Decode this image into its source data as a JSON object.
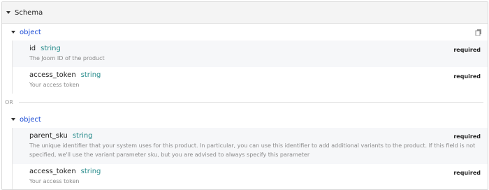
{
  "schema": {
    "title": "Schema"
  },
  "options": [
    {
      "type_label": "object",
      "properties": [
        {
          "name": "id",
          "type": "string",
          "required": "required",
          "description": "The Joom ID of the product"
        },
        {
          "name": "access_token",
          "type": "string",
          "required": "required",
          "description": "Your access token"
        }
      ]
    },
    {
      "type_label": "object",
      "properties": [
        {
          "name": "parent_sku",
          "type": "string",
          "required": "required",
          "description": "The unique identifier that your system uses for this product. In particular, you can use this identifier to add additional variants to the product. If this field is not specified, we'll use the variant parameter sku, but you are advised to always specify this parameter"
        },
        {
          "name": "access_token",
          "type": "string",
          "required": "required",
          "description": "Your access token"
        }
      ]
    }
  ],
  "separator": {
    "label": "OR"
  },
  "icons": {
    "collapse": "caret-down-icon",
    "copy": "copy-icon"
  }
}
